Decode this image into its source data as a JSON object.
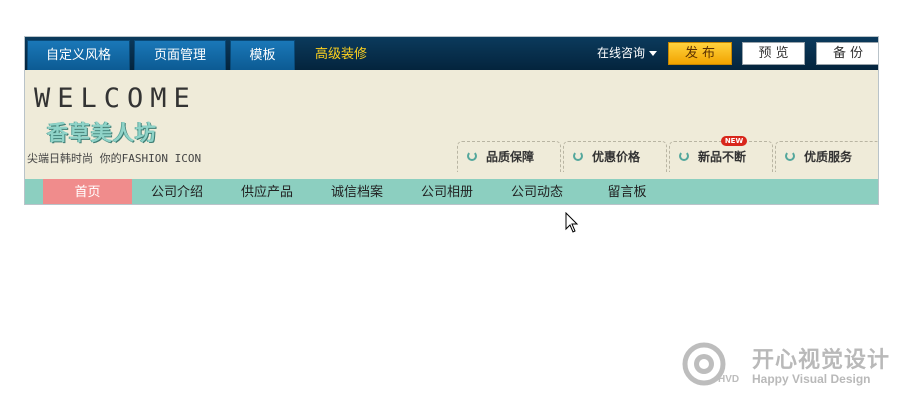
{
  "toolbar": {
    "tabs": [
      "自定义风格",
      "页面管理",
      "模板",
      "高级装修"
    ],
    "consult_label": "在线咨询",
    "publish_label": "发布",
    "preview_label": "预览",
    "backup_label": "备份"
  },
  "banner": {
    "welcome": "WELCOME",
    "brand": "香草美人坊",
    "slogan": "尖端日韩时尚 你的FASHION ICON",
    "features": [
      "品质保障",
      "优惠价格",
      "新品不断",
      "优质服务"
    ],
    "new_badge": "NEW"
  },
  "nav": {
    "items": [
      "首页",
      "公司介绍",
      "供应产品",
      "诚信档案",
      "公司相册",
      "公司动态",
      "留言板"
    ]
  },
  "watermark": {
    "logo_text": "HVD",
    "title": "开心视觉设计",
    "subtitle": "Happy Visual Design"
  },
  "colors": {
    "toolbar_bg": "#04243d",
    "accent_gold": "#ffd21e",
    "nav_bg": "#8ccfc0",
    "nav_home_bg": "#f08c8c",
    "banner_bg": "#efebd9"
  },
  "icons": [
    "caret-down-icon",
    "ring-icon",
    "mouse-cursor-icon"
  ]
}
